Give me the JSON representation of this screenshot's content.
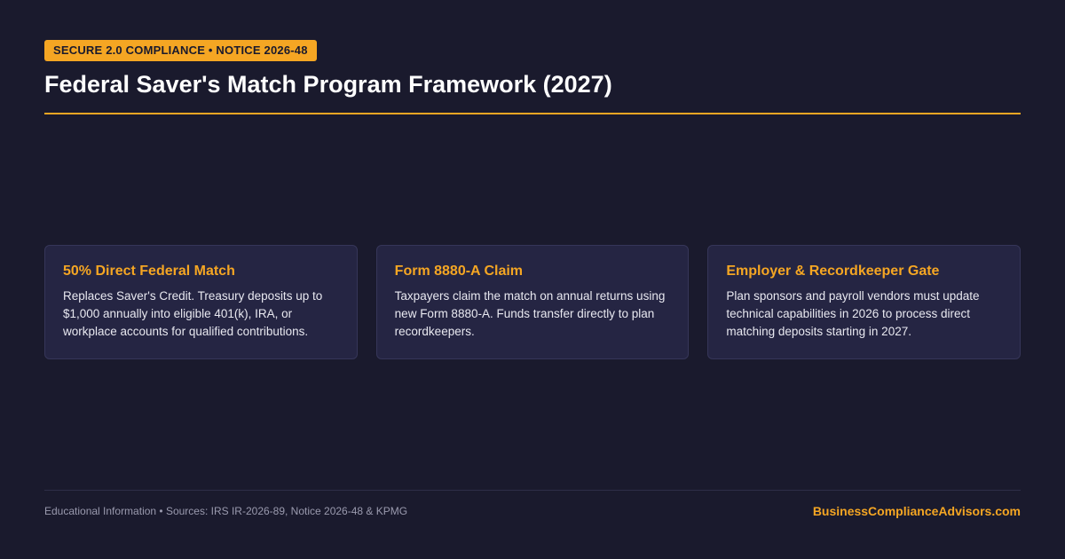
{
  "badge": "SECURE 2.0 COMPLIANCE • NOTICE 2026-48",
  "title": "Federal Saver's Match Program Framework (2027)",
  "cards": [
    {
      "title": "50% Direct Federal Match",
      "body": "Replaces Saver's Credit. Treasury deposits up to $1,000 annually into eligible 401(k), IRA, or workplace accounts for qualified contributions."
    },
    {
      "title": "Form 8880-A Claim",
      "body": "Taxpayers claim the match on annual returns using new Form 8880-A. Funds transfer directly to plan recordkeepers."
    },
    {
      "title": "Employer & Recordkeeper Gate",
      "body": "Plan sponsors and payroll vendors must update technical capabilities in 2026 to process direct matching deposits starting in 2027."
    }
  ],
  "footer": {
    "disclaimer": "Educational Information • Sources: IRS IR-2026-89, Notice 2026-48 & KPMG",
    "brand": "BusinessComplianceAdvisors.com"
  },
  "colors": {
    "background": "#1a1a2d",
    "accent": "#f5a623",
    "card": "#252543"
  }
}
